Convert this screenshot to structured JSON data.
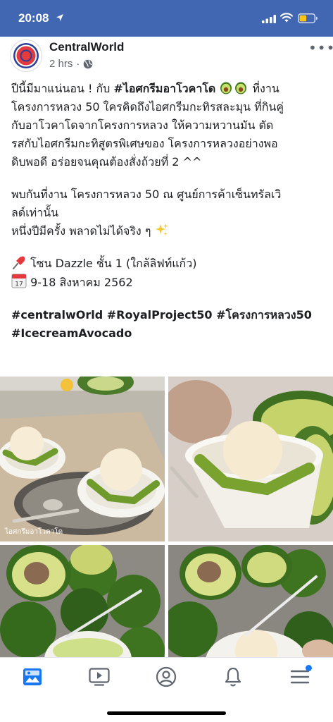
{
  "status_bar": {
    "time": "20:08"
  },
  "post": {
    "page_name": "CentralWorld",
    "time_ago": "2 hrs",
    "separator": "·",
    "more": "•••",
    "text": {
      "l1_a": "ปีนี้มีมาแน่นอน ! กับ ",
      "l1_tag": "#ไอศกรีมอาโวคาโด",
      "l1_b": " ที่งาน",
      "l2": "โครงการหลวง 50 ใครคิดถึงไอศกรีมกะทิรสละมุน ที่กินคู่",
      "l3": "กับอาโวคาโดจากโครงการหลวง ให้ความหวานมัน ตัด",
      "l4": "รสกับไอศกรีมกะทิสูตรพิเศษของ โครงการหลวงอย่างพอ",
      "l5": "ดิบพอดี อร่อยจนคุณต้องสั่งถ้วยที่ 2 ^^",
      "l6": "พบกันที่งาน โครงการหลวง 50 ณ ศูนย์การค้าเซ็นทรัลเวิ",
      "l7": "ลด์เท่านั้น",
      "l8": "หนึ่งปีมีครั้ง พลาดไม่ได้จริง ๆ ",
      "l9": " โซน Dazzle ชั้น 1 (ใกล้ลิฟท์แก้ว)",
      "l10": " 9-18 สิงหาคม 2562",
      "l11": "#centralwOrld #RoyalProject50 #โครงการหลวง50",
      "l12": "#IcecreamAvocado"
    },
    "photo_caption": "ไอศกรีมอาโวคาโด"
  },
  "icons": [
    "location-arrow-icon",
    "signal-icon",
    "wifi-icon",
    "battery-icon",
    "globe-icon",
    "avocado-emoji-icon",
    "sparkles-emoji-icon",
    "pushpin-emoji-icon",
    "calendar-emoji-icon",
    "feed-icon",
    "watch-icon",
    "profile-icon",
    "bell-icon",
    "menu-icon"
  ],
  "colors": {
    "facebook_blue": "#4267b2",
    "text": "#1c1e21",
    "meta": "#606770",
    "notification": "#1877f2",
    "battery": "#f5c518"
  }
}
